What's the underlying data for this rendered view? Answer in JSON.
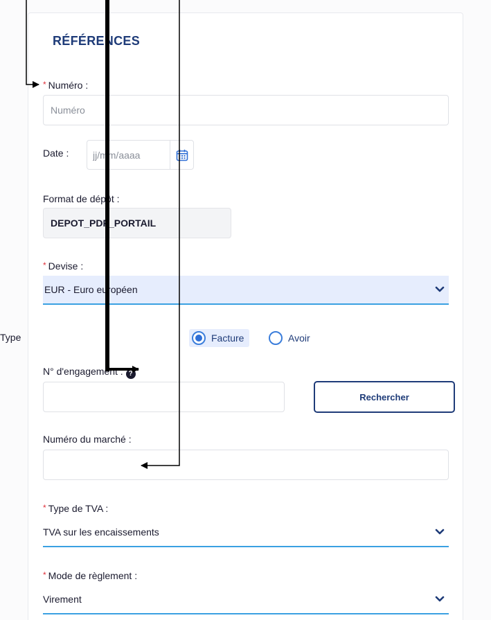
{
  "section": {
    "title": "RÉFÉRENCES"
  },
  "numero": {
    "required_mark": "*",
    "label": "Numéro :",
    "placeholder": "Numéro",
    "value": ""
  },
  "date": {
    "label": "Date :",
    "placeholder": "jj/mm/aaaa",
    "value": "",
    "icon": "calendar-icon"
  },
  "format_depot": {
    "label": "Format de dépôt :",
    "value": "DEPOT_PDF_PORTAIL"
  },
  "devise": {
    "required_mark": "*",
    "label": "Devise :",
    "value": "EUR - Euro européen",
    "icon": "chevron-down-icon"
  },
  "type": {
    "label": "Type",
    "options": [
      {
        "label": "Facture",
        "selected": true
      },
      {
        "label": "Avoir",
        "selected": false
      }
    ]
  },
  "engagement": {
    "label": "N° d'engagement :",
    "help_icon": "?",
    "value": "",
    "button_label": "Rechercher"
  },
  "marche": {
    "label": "Numéro du marché :",
    "value": ""
  },
  "tva": {
    "required_mark": "*",
    "label": "Type de TVA :",
    "value": "TVA sur les encaissements",
    "icon": "chevron-down-icon"
  },
  "reglement": {
    "required_mark": "*",
    "label": "Mode de règlement :",
    "value": "Virement",
    "icon": "chevron-down-icon"
  },
  "colors": {
    "brand": "#1e3b78",
    "accent": "#3aa0e2",
    "required": "#e0303a",
    "highlight": "#e6edfd"
  }
}
